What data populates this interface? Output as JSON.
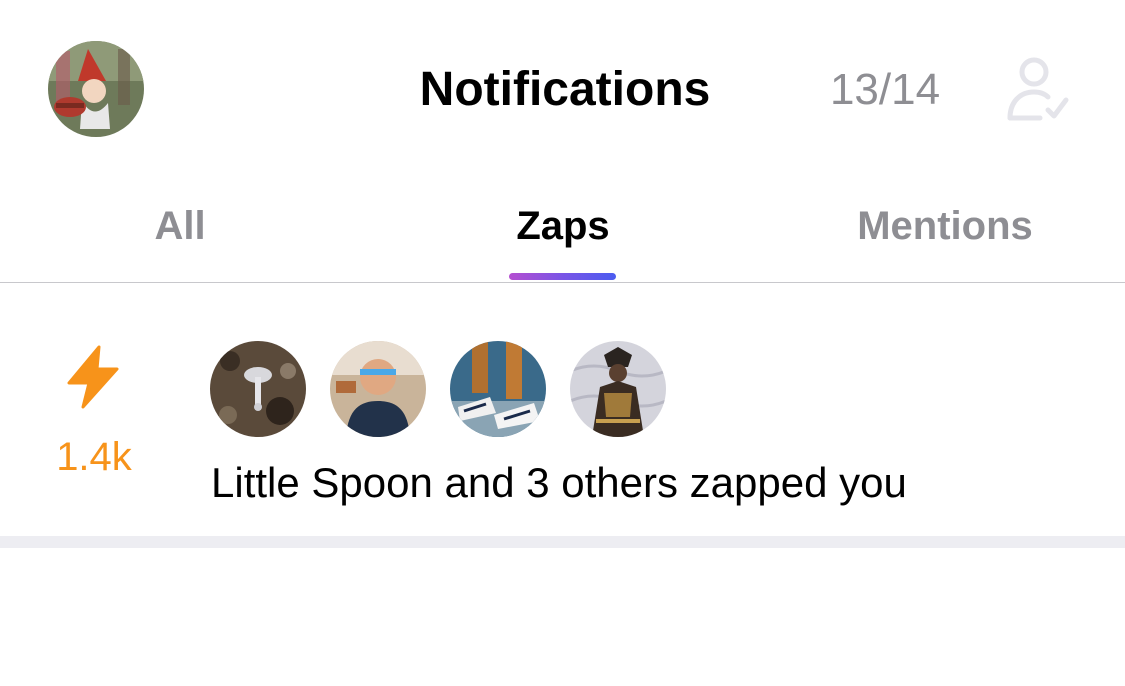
{
  "header": {
    "title": "Notifications",
    "counter": "13/14",
    "relay_icon": "person-check-icon"
  },
  "tabs": [
    {
      "label": "All",
      "selected": false
    },
    {
      "label": "Zaps",
      "selected": true
    },
    {
      "label": "Mentions",
      "selected": false
    }
  ],
  "notification": {
    "icon": "lightning-bolt-icon",
    "amount": "1.4k",
    "text": "Little Spoon and 3 others zapped you",
    "zapper_count_shown": 4
  },
  "colors": {
    "zap_orange": "#f7931a",
    "muted_gray": "#8e8e93",
    "tab_indicator_start": "#b44ed0",
    "tab_indicator_end": "#4b5cf0",
    "separator": "#ededf2"
  }
}
